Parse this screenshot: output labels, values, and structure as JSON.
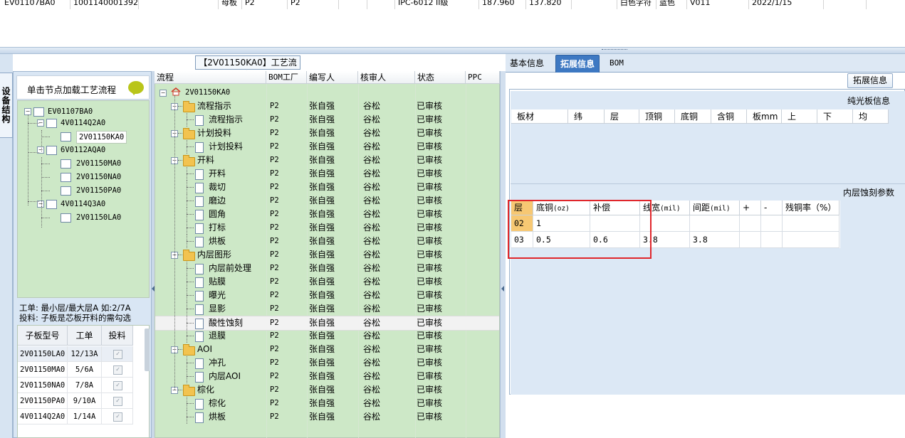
{
  "top_grid": {
    "cells": [
      "EV01107BA0",
      "10011400013920",
      "",
      "母板",
      "P2",
      "P2",
      "",
      "",
      "IPC-6012 II级",
      "187.960",
      "137.820",
      "",
      "白色字符",
      "蓝色",
      "V011",
      "2022/1/15",
      ""
    ]
  },
  "left_panel": {
    "side_tab_label": "设备结构",
    "header_text": "单击节点加载工艺流程",
    "tree": [
      {
        "label": "EV01107BA0",
        "level": 0
      },
      {
        "label": "4V0114Q2A0",
        "level": 1
      },
      {
        "label": "2V01150KA0",
        "level": 2,
        "selected": true
      },
      {
        "label": "6V0112AQA0",
        "level": 1
      },
      {
        "label": "2V01150MA0",
        "level": 2
      },
      {
        "label": "2V01150NA0",
        "level": 2
      },
      {
        "label": "2V01150PA0",
        "level": 2
      },
      {
        "label": "4V0114Q3A0",
        "level": 1
      },
      {
        "label": "2V01150LA0",
        "level": 2
      }
    ],
    "note_line1": "工单: 最小层/最大层A 如:2/7A",
    "note_line2": "投料: 子板是芯板开料的需勾选",
    "sub_grid": {
      "headers": [
        "子板型号",
        "工单",
        "投料"
      ],
      "rows": [
        {
          "model": "2V01150LA0",
          "order": "12/13A",
          "checked": true
        },
        {
          "model": "2V01150MA0",
          "order": "5/6A",
          "checked": true
        },
        {
          "model": "2V01150NA0",
          "order": "7/8A",
          "checked": true
        },
        {
          "model": "2V01150PA0",
          "order": "9/10A",
          "checked": true
        },
        {
          "model": "4V0114Q2A0",
          "order": "1/14A",
          "checked": true
        }
      ]
    }
  },
  "mid_panel": {
    "title": "【2V01150KA0】工艺流程",
    "headers": [
      "流程",
      "BOM工厂",
      "编写人",
      "核审人",
      "状态",
      "PPC"
    ],
    "root_label": "2V01150KA0",
    "rows": [
      {
        "type": "folder",
        "label": "流程指示",
        "bom": "P2",
        "writer": "张自强",
        "reviewer": "谷松",
        "status": "已审核"
      },
      {
        "type": "item",
        "label": "流程指示",
        "bom": "P2",
        "writer": "张自强",
        "reviewer": "谷松",
        "status": "已审核"
      },
      {
        "type": "folder",
        "label": "计划投料",
        "bom": "P2",
        "writer": "张自强",
        "reviewer": "谷松",
        "status": "已审核"
      },
      {
        "type": "item",
        "label": "计划投料",
        "bom": "P2",
        "writer": "张自强",
        "reviewer": "谷松",
        "status": "已审核"
      },
      {
        "type": "folder",
        "label": "开料",
        "bom": "P2",
        "writer": "张自强",
        "reviewer": "谷松",
        "status": "已审核"
      },
      {
        "type": "item",
        "label": "开料",
        "bom": "P2",
        "writer": "张自强",
        "reviewer": "谷松",
        "status": "已审核"
      },
      {
        "type": "item",
        "label": "裁切",
        "bom": "P2",
        "writer": "张自强",
        "reviewer": "谷松",
        "status": "已审核"
      },
      {
        "type": "item",
        "label": "磨边",
        "bom": "P2",
        "writer": "张自强",
        "reviewer": "谷松",
        "status": "已审核"
      },
      {
        "type": "item",
        "label": "圆角",
        "bom": "P2",
        "writer": "张自强",
        "reviewer": "谷松",
        "status": "已审核"
      },
      {
        "type": "item",
        "label": "打标",
        "bom": "P2",
        "writer": "张自强",
        "reviewer": "谷松",
        "status": "已审核"
      },
      {
        "type": "item",
        "label": "烘板",
        "bom": "P2",
        "writer": "张自强",
        "reviewer": "谷松",
        "status": "已审核"
      },
      {
        "type": "folder",
        "label": "内层图形",
        "bom": "P2",
        "writer": "张自强",
        "reviewer": "谷松",
        "status": "已审核"
      },
      {
        "type": "item",
        "label": "内层前处理",
        "bom": "P2",
        "writer": "张自强",
        "reviewer": "谷松",
        "status": "已审核"
      },
      {
        "type": "item",
        "label": "贴膜",
        "bom": "P2",
        "writer": "张自强",
        "reviewer": "谷松",
        "status": "已审核"
      },
      {
        "type": "item",
        "label": "曝光",
        "bom": "P2",
        "writer": "张自强",
        "reviewer": "谷松",
        "status": "已审核"
      },
      {
        "type": "item",
        "label": "显影",
        "bom": "P2",
        "writer": "张自强",
        "reviewer": "谷松",
        "status": "已审核"
      },
      {
        "type": "item",
        "label": "酸性蚀刻",
        "bom": "P2",
        "writer": "张自强",
        "reviewer": "谷松",
        "status": "已审核",
        "highlight": true
      },
      {
        "type": "item",
        "label": "退膜",
        "bom": "P2",
        "writer": "张自强",
        "reviewer": "谷松",
        "status": "已审核"
      },
      {
        "type": "folder",
        "label": "AOI",
        "bom": "P2",
        "writer": "张自强",
        "reviewer": "谷松",
        "status": "已审核"
      },
      {
        "type": "item",
        "label": "冲孔",
        "bom": "P2",
        "writer": "张自强",
        "reviewer": "谷松",
        "status": "已审核"
      },
      {
        "type": "item",
        "label": "内层AOI",
        "bom": "P2",
        "writer": "张自强",
        "reviewer": "谷松",
        "status": "已审核"
      },
      {
        "type": "folder",
        "label": "棕化",
        "bom": "P2",
        "writer": "张自强",
        "reviewer": "谷松",
        "status": "已审核"
      },
      {
        "type": "item",
        "label": "棕化",
        "bom": "P2",
        "writer": "张自强",
        "reviewer": "谷松",
        "status": "已审核"
      },
      {
        "type": "item",
        "label": "烘板",
        "bom": "P2",
        "writer": "张自强",
        "reviewer": "谷松",
        "status": "已审核"
      }
    ]
  },
  "right_panel": {
    "tabs": [
      "基本信息",
      "拓展信息",
      "BOM"
    ],
    "active_tab": "拓展信息",
    "ext_button": "拓展信息",
    "bare_title": "纯光板信息",
    "bare_headers": [
      "板材",
      "纬",
      "层",
      "顶铜",
      "底铜",
      "含铜",
      "板mm",
      "上",
      "下",
      "均"
    ],
    "etch_title": "内层蚀刻参数",
    "etch_headers": [
      {
        "main": "层",
        "unit": ""
      },
      {
        "main": "底铜",
        "unit": "(oz)"
      },
      {
        "main": "补偿",
        "unit": ""
      },
      {
        "main": "线宽",
        "unit": "(mil)"
      },
      {
        "main": "间距",
        "unit": "(mil)"
      },
      {
        "main": "+",
        "unit": ""
      },
      {
        "main": "-",
        "unit": ""
      },
      {
        "main": "残铜率（%）",
        "unit": ""
      }
    ],
    "etch_rows": [
      [
        "02",
        "1",
        "",
        "",
        "",
        "",
        "",
        ""
      ],
      [
        "03",
        "0.5",
        "0.6",
        "3.8",
        "3.8",
        "",
        "",
        ""
      ]
    ]
  },
  "colors": {
    "accent_tab": "#3d78c2",
    "tree_bg": "#cde8c7",
    "highlight_box": "#e0262b"
  }
}
